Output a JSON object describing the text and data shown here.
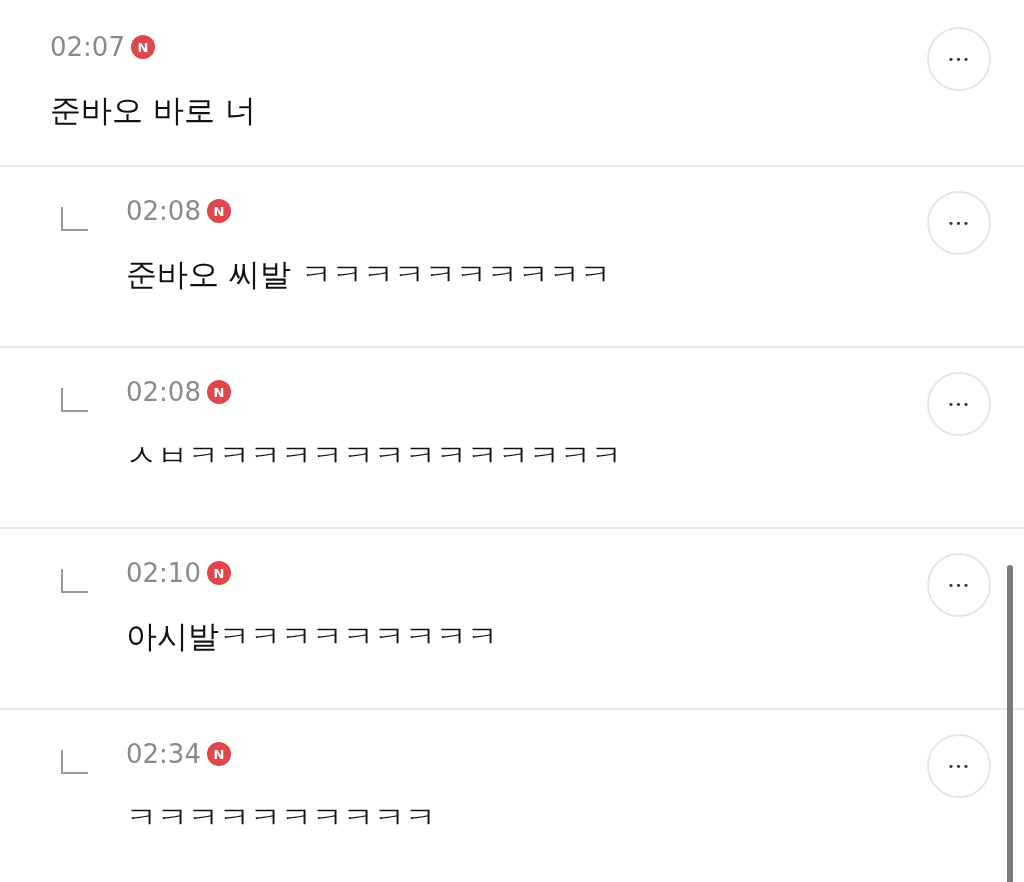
{
  "comments": [
    {
      "kind": "comment",
      "time": "02:07",
      "badge": "N",
      "text": "준바오 바로 너",
      "more": "•••"
    },
    {
      "kind": "reply",
      "time": "02:08",
      "badge": "N",
      "text": "준바오 씨발 ㅋㅋㅋㅋㅋㅋㅋㅋㅋㅋ",
      "more": "•••"
    },
    {
      "kind": "reply",
      "time": "02:08",
      "badge": "N",
      "text": "ㅅㅂㅋㅋㅋㅋㅋㅋㅋㅋㅋㅋㅋㅋㅋㅋ",
      "more": "•••"
    },
    {
      "kind": "reply",
      "time": "02:10",
      "badge": "N",
      "text": "아시발ㅋㅋㅋㅋㅋㅋㅋㅋㅋ",
      "more": "•••"
    },
    {
      "kind": "reply",
      "time": "02:34",
      "badge": "N",
      "text": "ㅋㅋㅋㅋㅋㅋㅋㅋㅋㅋ",
      "more": "•••"
    }
  ]
}
